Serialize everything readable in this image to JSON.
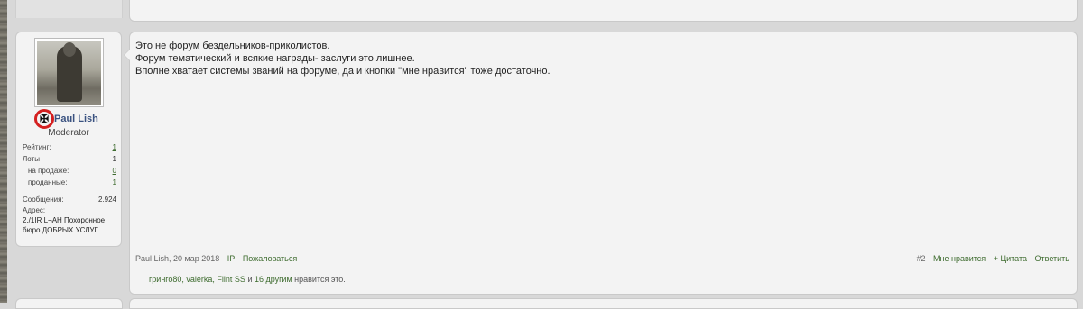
{
  "user": {
    "name": "Paul Lish",
    "title": "Moderator",
    "award_symbol": "✠",
    "stats": [
      {
        "label": "Рейтинг:",
        "value": "1",
        "link": true,
        "sub": false
      },
      {
        "label": "Лоты",
        "value": "1",
        "link": false,
        "sub": false
      },
      {
        "label": "на продаже:",
        "value": "0",
        "link": true,
        "sub": true
      },
      {
        "label": "проданные:",
        "value": "1",
        "link": true,
        "sub": true
      }
    ],
    "messages_label": "Сообщения:",
    "messages_value": "2.924",
    "address_label": "Адрес:",
    "address_value": "2./1IR L¬AH Похоронное бюро ДОБРЫХ УСЛУГ..."
  },
  "post": {
    "lines": [
      "Это не форум бездельников-приколистов.",
      "Форум тематический и всякие награды- заслуги это лишнее.",
      "Вполне хватает системы званий на форуме, да и кнопки \"мне нравится\" тоже достаточно."
    ],
    "meta": {
      "author_date": "Paul Lish, 20 мар 2018",
      "ip": "IP",
      "report": "Пожаловаться"
    },
    "actions": {
      "number": "#2",
      "like": "Мне нравится",
      "quote": "+ Цитата",
      "reply": "Ответить"
    },
    "likes": {
      "names": "гринго80, valerka, Flint SS",
      "and": "и",
      "others": "16 другим",
      "suffix": "нравится это."
    }
  }
}
